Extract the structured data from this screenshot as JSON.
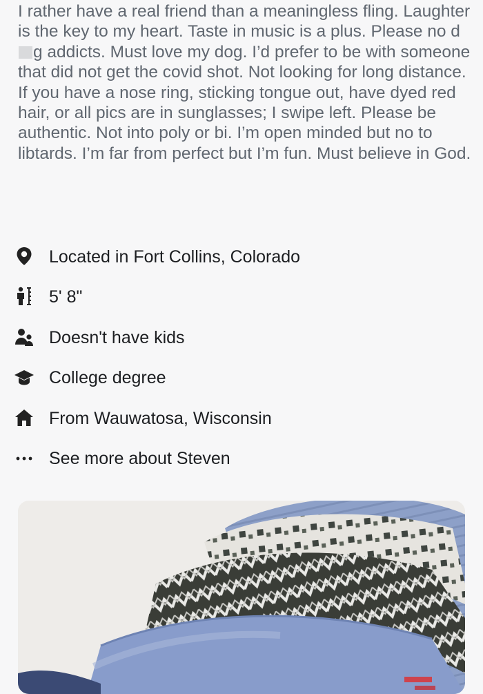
{
  "bio": {
    "before_redaction": "I rather have a real friend than a meaningless fling. Laughter is the key to my heart. Taste in music is a plus. Please no d",
    "after_redaction": "g addicts. Must love my dog. I’d prefer to be with someone that did not get the covid shot. Not looking for long distance. If you have a nose ring, sticking tongue out, have dyed red hair, or all pics are in sunglasses; I swipe left. Please be authentic. Not into poly or bi. I’m open minded but no to libtards. I’m far from perfect but I’m fun. Must believe in God."
  },
  "details": [
    {
      "icon": "location-pin-icon",
      "label": "Located in Fort Collins, Colorado"
    },
    {
      "icon": "height-icon",
      "label": "5' 8\""
    },
    {
      "icon": "kids-icon",
      "label": "Doesn't have kids"
    },
    {
      "icon": "graduation-cap-icon",
      "label": "College degree"
    },
    {
      "icon": "home-icon",
      "label": "From Wauwatosa, Wisconsin"
    },
    {
      "icon": "more-dots-icon",
      "label": "See more about Steven"
    }
  ],
  "colors": {
    "icon": "#222222",
    "text_primary": "#1c1e21",
    "text_secondary": "#606770",
    "background": "#f7f7f8"
  }
}
